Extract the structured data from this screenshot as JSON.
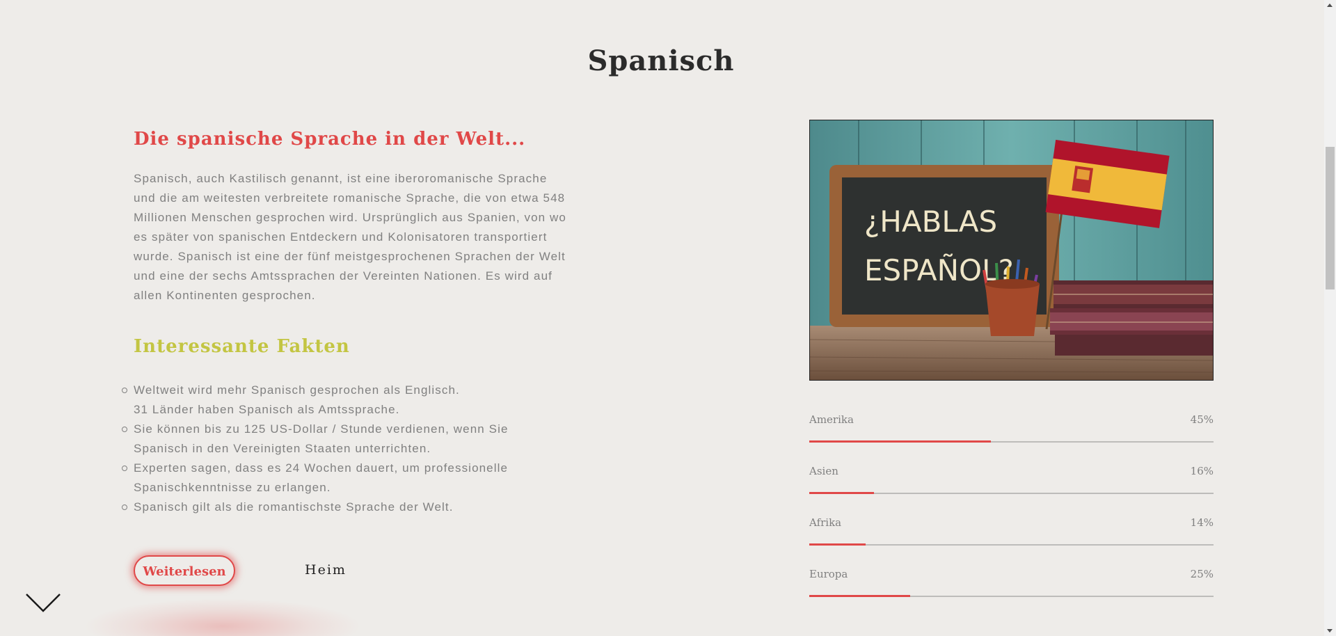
{
  "page": {
    "title": "Spanisch"
  },
  "intro": {
    "heading": "Die spanische Sprache in der Welt...",
    "text": "Spanisch, auch Kastilisch genannt, ist eine iberoromanische Sprache und die am weitesten verbreitete romanische Sprache, die von etwa 548 Millionen Menschen gesprochen wird. Ursprünglich aus Spanien, von wo es später von spanischen Entdeckern und Kolonisatoren transportiert wurde. Spanisch ist eine der fünf meistgesprochenen Sprachen der Welt und eine der sechs Amtssprachen der Vereinten Nationen. Es wird auf allen Kontinenten gesprochen."
  },
  "facts": {
    "heading": "Interessante Fakten",
    "items": [
      "Weltweit wird mehr Spanisch gesprochen als Englisch.",
      "31 Länder haben Spanisch als Amtssprache.",
      "Sie können bis zu 125 US-Dollar / Stunde verdienen, wenn Sie Spanisch in den Vereinigten Staaten unterrichten.",
      "Experten sagen, dass es 24 Wochen dauert, um professionelle Spanischkenntnisse zu erlangen.",
      "Spanisch gilt als die romantischste Sprache der Welt."
    ]
  },
  "buttons": {
    "read_more": "Weiterlesen",
    "home": "Heim"
  },
  "image": {
    "chalkboard_text_line1": "¿HABLAS",
    "chalkboard_text_line2": "ESPAÑOL?"
  },
  "stats": [
    {
      "label": "Amerika",
      "value": "45%",
      "percent": 45
    },
    {
      "label": "Asien",
      "value": "16%",
      "percent": 16
    },
    {
      "label": "Afrika",
      "value": "14%",
      "percent": 14
    },
    {
      "label": "Europa",
      "value": "25%",
      "percent": 25
    }
  ],
  "colors": {
    "background": "#eeece9",
    "accent_red": "#e04848",
    "accent_olive": "#c3c542",
    "body_text": "#808080"
  },
  "icons": {
    "scroll_down": "chevron-down-icon"
  }
}
